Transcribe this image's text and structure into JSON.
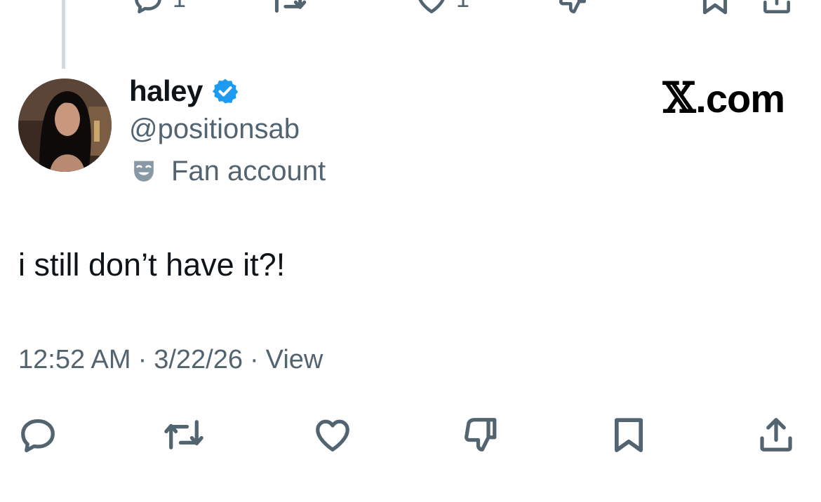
{
  "previous_tweet": {
    "reply_count": "1",
    "like_count": "1"
  },
  "tweet": {
    "display_name": "haley",
    "verified": true,
    "handle": "@positionsab",
    "account_label": "Fan account",
    "brand_x": "𝕏",
    "brand_domain": ".com",
    "text": "i still don’t have it?!",
    "time": "12:52 AM",
    "separator": "·",
    "date": "3/22/26",
    "views_label": "View"
  },
  "icons": {
    "reply": "reply-icon",
    "repost": "repost-icon",
    "like": "like-icon",
    "dislike": "dislike-icon",
    "bookmark": "bookmark-icon",
    "share": "share-icon",
    "verified": "verified-badge-icon",
    "label": "theater-masks-icon"
  },
  "colors": {
    "text_primary": "#0f1419",
    "text_secondary": "#536471",
    "verified_blue": "#1d9bf0",
    "thread_line": "#cfd9de"
  }
}
